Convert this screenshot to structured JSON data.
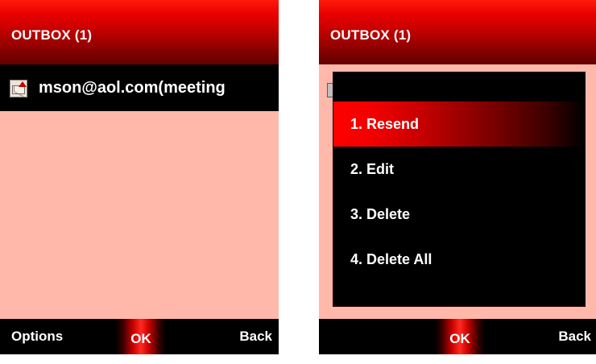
{
  "left_screen": {
    "title": "OUTBOX (1)",
    "item": {
      "label": "mson@aol.com(meeting"
    },
    "softkeys": {
      "left": "Options",
      "center": "OK",
      "right": "Back"
    }
  },
  "right_screen": {
    "title": "OUTBOX (1)",
    "menu_items": [
      {
        "label": "1. Resend"
      },
      {
        "label": "2. Edit"
      },
      {
        "label": "3. Delete"
      },
      {
        "label": "4. Delete All"
      }
    ],
    "softkeys": {
      "center": "OK",
      "right": "Back"
    }
  },
  "colors": {
    "accent_red": "#e10000",
    "title_bar_dark": "#650000",
    "list_bg": "#ffb8aa",
    "selected_row": "#000000",
    "softkey_bg": "#000000"
  },
  "icons": {
    "outbox_item": "outbox-message-icon"
  }
}
